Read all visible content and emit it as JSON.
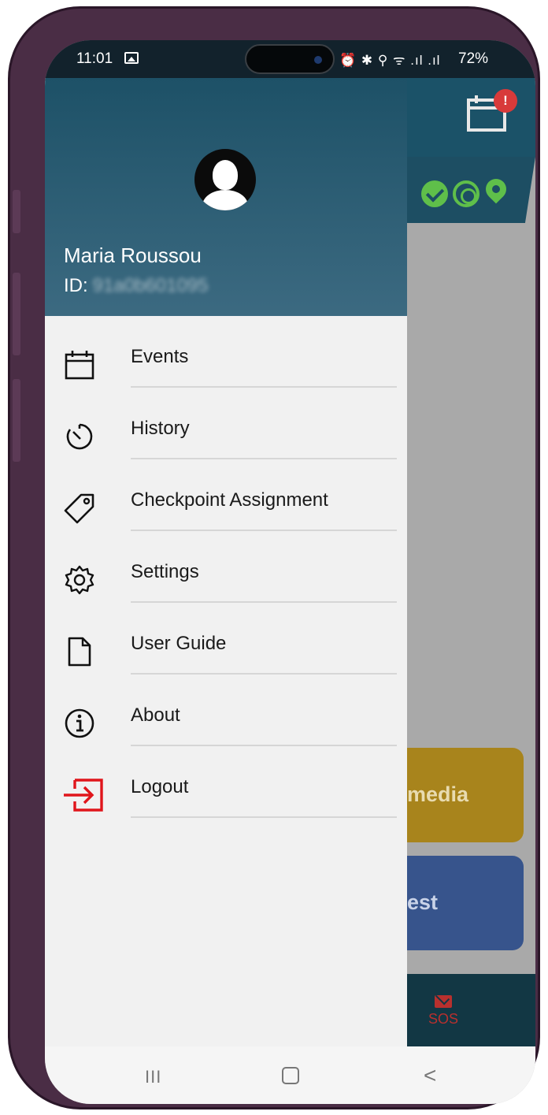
{
  "status_bar": {
    "time": "11:01",
    "right_icons": "⏰ ✱ ⚲ ᯤ .ıl .ıl",
    "battery": "72%"
  },
  "app": {
    "alert_badge": "!",
    "media_button_label": "media",
    "request_button_label": "est",
    "sos_label": "SOS"
  },
  "drawer": {
    "user_name": "Maria Roussou",
    "id_label": "ID:",
    "id_value": "91a0b601095",
    "menu": [
      {
        "label": "Events",
        "icon": "calendar-icon"
      },
      {
        "label": "History",
        "icon": "timer-icon"
      },
      {
        "label": "Checkpoint Assignment",
        "icon": "tag-icon"
      },
      {
        "label": "Settings",
        "icon": "gear-icon"
      },
      {
        "label": "User Guide",
        "icon": "document-icon"
      },
      {
        "label": "About",
        "icon": "info-icon"
      },
      {
        "label": "Logout",
        "icon": "logout-icon"
      }
    ]
  },
  "nav": {
    "recent": "III",
    "back": "<"
  },
  "colors": {
    "header": "#1d5167",
    "logout_accent": "#e0151b",
    "status_ok": "#5fbf4a",
    "sos": "#b8302e"
  }
}
